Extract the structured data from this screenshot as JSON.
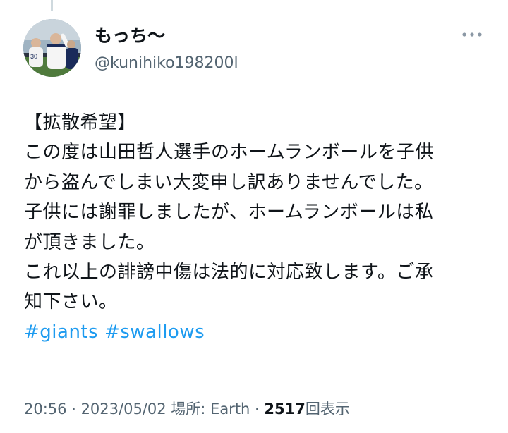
{
  "author": {
    "display_name": "もっち〜",
    "handle": "@kunihiko198200l"
  },
  "tweet": {
    "lines": [
      "【拡散希望】",
      "この度は山田哲人選手のホームランボールを子供",
      "から盗んでしまい大変申し訳ありませんでした。",
      "子供には謝罪しましたが、ホームランボールは私",
      "が頂きました。",
      "これ以上の誹謗中傷は法的に対応致します。ご承",
      "知下さい。"
    ],
    "hashtags": [
      "#giants",
      "#swallows"
    ]
  },
  "meta": {
    "time": "20:56",
    "separator": " · ",
    "date": "2023/05/02",
    "location": "場所: Earth",
    "views_count": "2517",
    "views_label": "回表示"
  },
  "icons": {
    "more": "more-horizontal-icon"
  },
  "colors": {
    "link": "#1d9bf0",
    "secondary_text": "#536471",
    "primary_text": "#0f1419"
  }
}
